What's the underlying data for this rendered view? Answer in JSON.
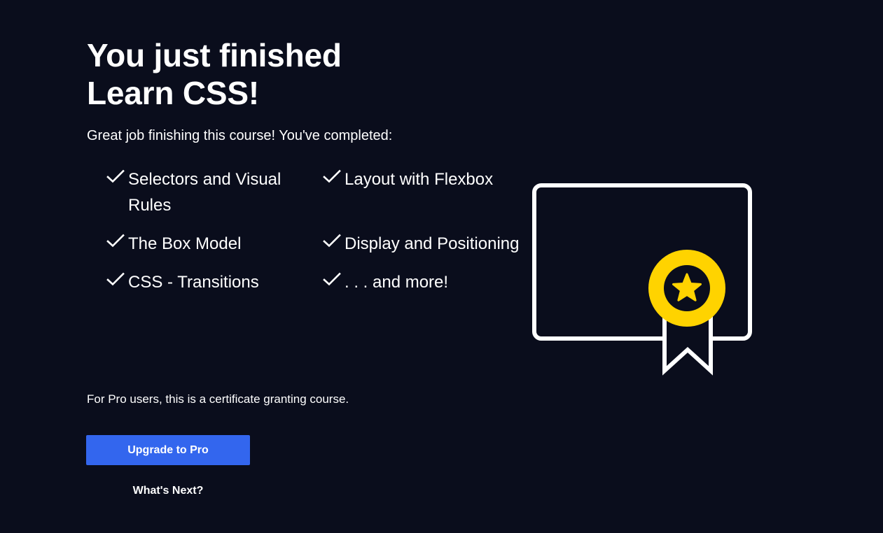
{
  "completion": {
    "title_line1": "You just finished",
    "title_line2": "Learn CSS!",
    "intro": "Great job finishing this course! You've completed:",
    "topics": [
      {
        "label": "Selectors and Visual Rules",
        "icon": "check-icon"
      },
      {
        "label": "Layout with Flexbox",
        "icon": "check-icon"
      },
      {
        "label": "The Box Model",
        "icon": "check-icon"
      },
      {
        "label": "Display and Positioning",
        "icon": "check-icon"
      },
      {
        "label": "CSS - Transitions",
        "icon": "check-icon"
      },
      {
        "label": ". . . and more!",
        "icon": "check-icon"
      }
    ],
    "pro_note": "For Pro users, this is a certificate granting course.",
    "upgrade_button": "Upgrade to Pro",
    "next_link": "What's Next?"
  },
  "illustration": {
    "icon": "certificate-icon",
    "badge_icon": "star-icon"
  },
  "colors": {
    "background": "#0a0d1c",
    "text": "#ffffff",
    "button": "#3366ee",
    "badge": "#ffd300"
  }
}
